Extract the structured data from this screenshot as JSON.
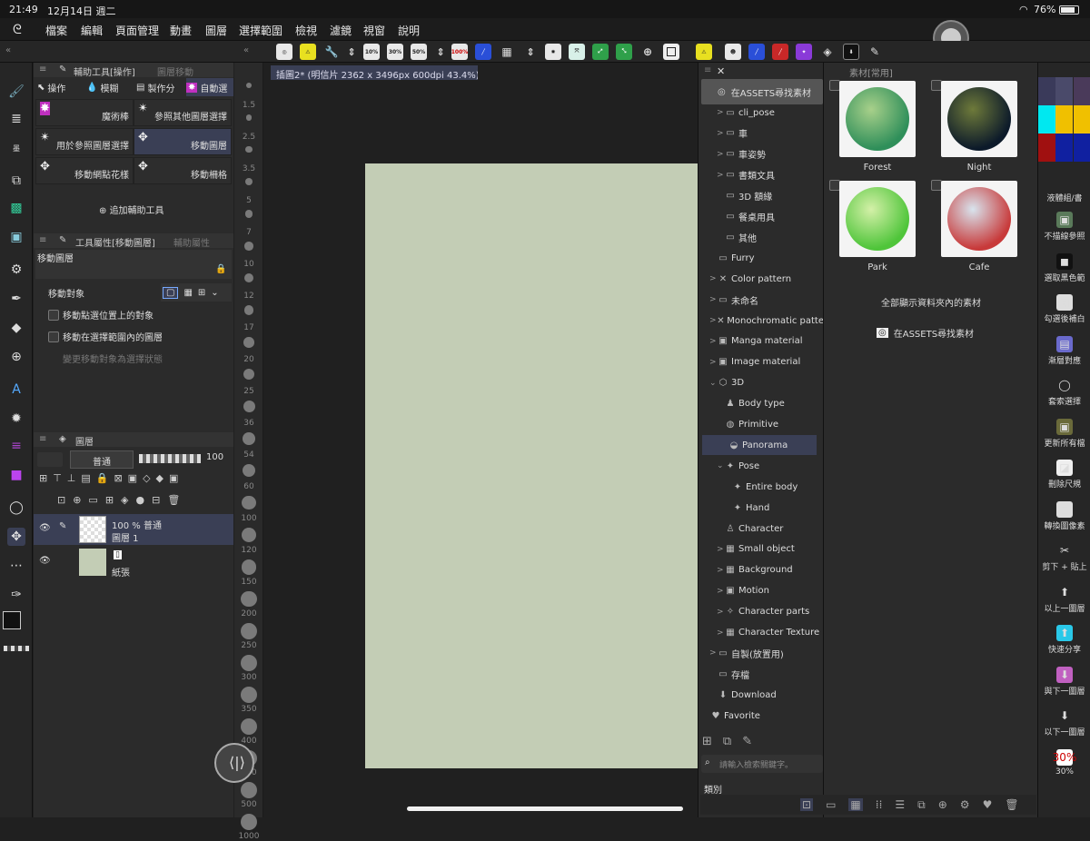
{
  "status": {
    "time": "21:49",
    "date": "12月14日 週二",
    "battery": "76%"
  },
  "menu": [
    "檔案",
    "編輯",
    "頁面管理",
    "動畫",
    "圖層",
    "選擇範圍",
    "檢視",
    "濾鏡",
    "視窗",
    "說明"
  ],
  "toolbar": {
    "zoom10": "10%",
    "zoom30": "30%",
    "zoom50": "50%",
    "zoom100": "100%"
  },
  "subtool": {
    "panel_title": "輔助工具[操作]",
    "panel_tab2": "圖層移動",
    "tabs": [
      "操作",
      "模糊",
      "製作分",
      "自動選"
    ],
    "items": [
      "魔術棒",
      "參照其他圖層選擇",
      "用於參照圖層選擇",
      "移動圖層",
      "移動網點花樣",
      "移動柵格"
    ],
    "add_label": "追加輔助工具"
  },
  "toolprop": {
    "panel_title": "工具屬性[移動圖層]",
    "panel_tab2": "輔助屬性",
    "tool_name": "移動圖層",
    "target_label": "移動對象",
    "check1": "移動點選位置上的對象",
    "check2": "移動在選擇範圍內的圖層",
    "check3": "變更移動對象為選擇狀態"
  },
  "layers": {
    "panel_title": "圖層",
    "blend_mode": "普通",
    "opacity": "100",
    "layer1_info": "100 % 普通",
    "layer1_name": "圖層 1",
    "paper_name": "紙張"
  },
  "ruler": [
    "1.5",
    "2.5",
    "3.5",
    "5",
    "7",
    "10",
    "12",
    "17",
    "20",
    "25",
    "36",
    "54",
    "60",
    "100",
    "120",
    "150",
    "200",
    "250",
    "300",
    "350",
    "400",
    "450",
    "500",
    "1000"
  ],
  "document": {
    "tab": "插圖2* (明信片 2362 x 3496px 600dpi 43.4%)"
  },
  "material": {
    "panel_title": "素材[常用]",
    "find_assets": "在ASSETS尋找素材",
    "tree": [
      {
        "label": "cli_pose",
        "indent": 2
      },
      {
        "label": "車",
        "indent": 2
      },
      {
        "label": "車姿勢",
        "indent": 2
      },
      {
        "label": "書類文具",
        "indent": 2
      },
      {
        "label": "3D 額緣",
        "indent": 2
      },
      {
        "label": "餐桌用具",
        "indent": 2
      },
      {
        "label": "其他",
        "indent": 2
      },
      {
        "label": "Furry",
        "indent": 1
      },
      {
        "label": "Color pattern",
        "indent": 1
      },
      {
        "label": "未命名",
        "indent": 1
      },
      {
        "label": "Monochromatic patte",
        "indent": 1
      },
      {
        "label": "Manga material",
        "indent": 1
      },
      {
        "label": "Image material",
        "indent": 1
      },
      {
        "label": "3D",
        "indent": 1
      },
      {
        "label": "Body type",
        "indent": 2
      },
      {
        "label": "Primitive",
        "indent": 2
      },
      {
        "label": "Panorama",
        "indent": 2
      },
      {
        "label": "Pose",
        "indent": 2
      },
      {
        "label": "Entire body",
        "indent": 3
      },
      {
        "label": "Hand",
        "indent": 3
      },
      {
        "label": "Character",
        "indent": 2
      },
      {
        "label": "Small object",
        "indent": 2
      },
      {
        "label": "Background",
        "indent": 2
      },
      {
        "label": "Motion",
        "indent": 2
      },
      {
        "label": "Character parts",
        "indent": 2
      },
      {
        "label": "Character Texture",
        "indent": 2
      },
      {
        "label": "自製(放置用)",
        "indent": 1
      },
      {
        "label": "存檔",
        "indent": 1
      },
      {
        "label": "Download",
        "indent": 1
      },
      {
        "label": "Favorite",
        "indent": 0
      }
    ],
    "search_placeholder": "請輸入檢索關鍵字。",
    "category_label": "類別",
    "thumbs": [
      {
        "label": "Forest",
        "color1": "#2f8f5a",
        "color2": "#a8d08a"
      },
      {
        "label": "Night",
        "color1": "#0c1a2a",
        "color2": "#6e7a3a"
      },
      {
        "label": "Park",
        "color1": "#4fc53a",
        "color2": "#d4f0a8"
      },
      {
        "label": "Cafe",
        "color1": "#c83a3a",
        "color2": "#d8e4ee"
      }
    ],
    "show_all": "全部顯示資料夾內的素材",
    "find_assets2": "在ASSETS尋找素材"
  },
  "rightbar": {
    "header": "液體組/書",
    "items": [
      "不描線參照",
      "選取黑色範",
      "勾選後補白",
      "漸層對應",
      "套索選擇",
      "更新所有檔",
      "刪除尺規",
      "轉換圖像素",
      "剪下 + 貼上",
      "以上一圖層",
      "快速分享",
      "與下一圖層",
      "以下一圖層",
      "30%"
    ],
    "zoom_icon": "30%"
  },
  "colors": {
    "paper": "#c3cdb5",
    "accent": "#3a3f55"
  }
}
